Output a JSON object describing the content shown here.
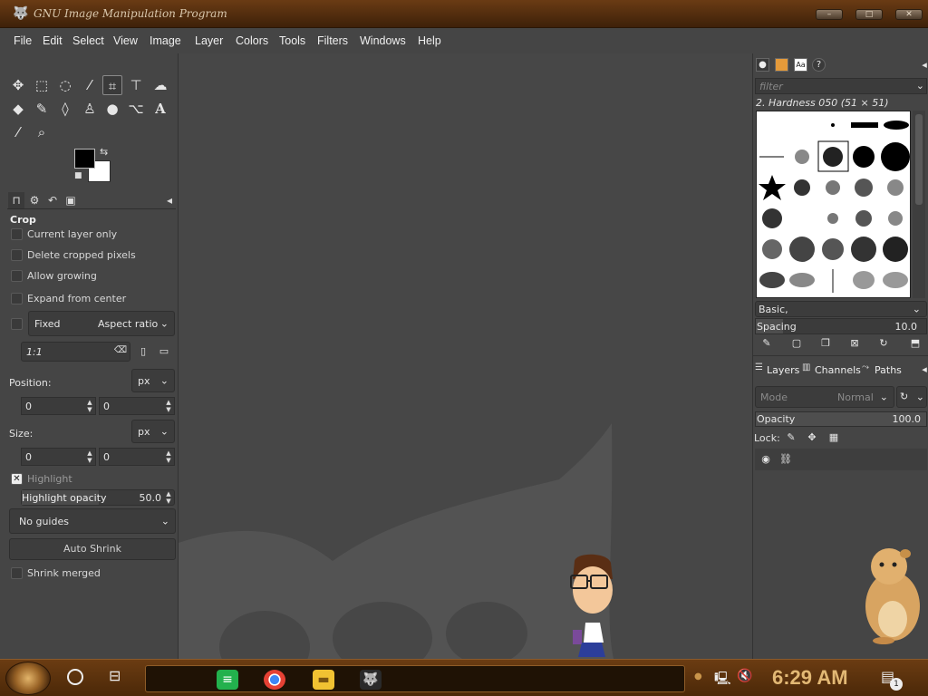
{
  "window": {
    "title": "GNU Image Manipulation Program",
    "controls": {
      "minimize": "–",
      "maximize": "□",
      "close": "✕"
    }
  },
  "menu": [
    "File",
    "Edit",
    "Select",
    "View",
    "Image",
    "Layer",
    "Colors",
    "Tools",
    "Filters",
    "Windows",
    "Help"
  ],
  "tool_options": {
    "title": "Crop",
    "current_layer_only": "Current layer only",
    "delete_cropped_pixels": "Delete cropped pixels",
    "allow_growing": "Allow growing",
    "expand_from_center": "Expand from center",
    "fixed_label": "Fixed",
    "fixed_mode": "Aspect ratio",
    "ratio_value": "1:1",
    "position_label": "Position:",
    "position_unit": "px",
    "position_x": "0",
    "position_y": "0",
    "size_label": "Size:",
    "size_unit": "px",
    "size_w": "0",
    "size_h": "0",
    "highlight_label": "Highlight",
    "highlight_opacity_label": "Highlight opacity",
    "highlight_opacity_value": "50.0",
    "guides": "No guides",
    "auto_shrink": "Auto Shrink",
    "shrink_merged": "Shrink merged"
  },
  "brushes": {
    "filter_placeholder": "filter",
    "selected_brush": "2. Hardness 050 (51 × 51)",
    "tag": "Basic,",
    "spacing_label": "Spacing",
    "spacing_value": "10.0"
  },
  "layers_panel": {
    "tabs": [
      "Layers",
      "Channels",
      "Paths"
    ],
    "mode_label": "Mode",
    "mode_value": "Normal",
    "opacity_label": "Opacity",
    "opacity_value": "100.0",
    "lock_label": "Lock:"
  },
  "taskbar": {
    "clock": "6:29 AM",
    "notification_count": "1"
  },
  "colors": {
    "foreground": "#000000",
    "background": "#ffffff",
    "taskbar_accent": "#e2b874"
  }
}
